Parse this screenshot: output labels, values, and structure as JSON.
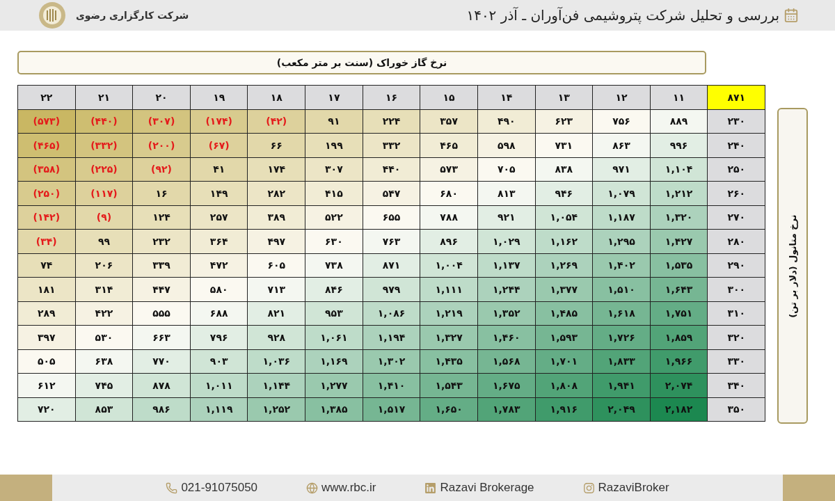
{
  "header": {
    "title": "بررسی و تحلیل شرکت پتروشیمی فن‌آوران ـ آذر ۱۴۰۲",
    "company": "شرکت کارگزاری رضوی"
  },
  "table_title": "نرخ گاز خوراک (سنت بر متر مکعب)",
  "side_label": "نرخ متانول (دلار بر تن)",
  "table": {
    "corner": "۸۷۱",
    "columns": [
      "۱۱",
      "۱۲",
      "۱۳",
      "۱۴",
      "۱۵",
      "۱۶",
      "۱۷",
      "۱۸",
      "۱۹",
      "۲۰",
      "۲۱",
      "۲۲"
    ],
    "rows": [
      {
        "label": "۲۳۰",
        "cells": [
          {
            "value": "۸۸۹",
            "negative": false
          },
          {
            "value": "۷۵۶",
            "negative": false
          },
          {
            "value": "۶۲۳",
            "negative": false
          },
          {
            "value": "۴۹۰",
            "negative": false
          },
          {
            "value": "۳۵۷",
            "negative": false
          },
          {
            "value": "۲۲۴",
            "negative": false
          },
          {
            "value": "۹۱",
            "negative": false
          },
          {
            "value": "(۴۲)",
            "negative": true
          },
          {
            "value": "(۱۷۴)",
            "negative": true
          },
          {
            "value": "(۳۰۷)",
            "negative": true
          },
          {
            "value": "(۴۴۰)",
            "negative": true
          },
          {
            "value": "(۵۷۳)",
            "negative": true
          }
        ]
      },
      {
        "label": "۲۴۰",
        "cells": [
          {
            "value": "۹۹۶",
            "negative": false
          },
          {
            "value": "۸۶۳",
            "negative": false
          },
          {
            "value": "۷۳۱",
            "negative": false
          },
          {
            "value": "۵۹۸",
            "negative": false
          },
          {
            "value": "۴۶۵",
            "negative": false
          },
          {
            "value": "۳۳۲",
            "negative": false
          },
          {
            "value": "۱۹۹",
            "negative": false
          },
          {
            "value": "۶۶",
            "negative": false
          },
          {
            "value": "(۶۷)",
            "negative": true
          },
          {
            "value": "(۲۰۰)",
            "negative": true
          },
          {
            "value": "(۳۳۲)",
            "negative": true
          },
          {
            "value": "(۴۶۵)",
            "negative": true
          }
        ]
      },
      {
        "label": "۲۵۰",
        "cells": [
          {
            "value": "۱,۱۰۴",
            "negative": false
          },
          {
            "value": "۹۷۱",
            "negative": false
          },
          {
            "value": "۸۳۸",
            "negative": false
          },
          {
            "value": "۷۰۵",
            "negative": false
          },
          {
            "value": "۵۷۳",
            "negative": false
          },
          {
            "value": "۴۴۰",
            "negative": false
          },
          {
            "value": "۳۰۷",
            "negative": false
          },
          {
            "value": "۱۷۴",
            "negative": false
          },
          {
            "value": "۴۱",
            "negative": false
          },
          {
            "value": "(۹۲)",
            "negative": true
          },
          {
            "value": "(۲۲۵)",
            "negative": true
          },
          {
            "value": "(۳۵۸)",
            "negative": true
          }
        ]
      },
      {
        "label": "۲۶۰",
        "cells": [
          {
            "value": "۱,۲۱۲",
            "negative": false
          },
          {
            "value": "۱,۰۷۹",
            "negative": false
          },
          {
            "value": "۹۴۶",
            "negative": false
          },
          {
            "value": "۸۱۳",
            "negative": false
          },
          {
            "value": "۶۸۰",
            "negative": false
          },
          {
            "value": "۵۴۷",
            "negative": false
          },
          {
            "value": "۴۱۵",
            "negative": false
          },
          {
            "value": "۲۸۲",
            "negative": false
          },
          {
            "value": "۱۴۹",
            "negative": false
          },
          {
            "value": "۱۶",
            "negative": false
          },
          {
            "value": "(۱۱۷)",
            "negative": true
          },
          {
            "value": "(۲۵۰)",
            "negative": true
          }
        ]
      },
      {
        "label": "۲۷۰",
        "cells": [
          {
            "value": "۱,۳۲۰",
            "negative": false
          },
          {
            "value": "۱,۱۸۷",
            "negative": false
          },
          {
            "value": "۱,۰۵۴",
            "negative": false
          },
          {
            "value": "۹۲۱",
            "negative": false
          },
          {
            "value": "۷۸۸",
            "negative": false
          },
          {
            "value": "۶۵۵",
            "negative": false
          },
          {
            "value": "۵۲۲",
            "negative": false
          },
          {
            "value": "۳۸۹",
            "negative": false
          },
          {
            "value": "۲۵۷",
            "negative": false
          },
          {
            "value": "۱۲۴",
            "negative": false
          },
          {
            "value": "(۹)",
            "negative": true
          },
          {
            "value": "(۱۴۲)",
            "negative": true
          }
        ]
      },
      {
        "label": "۲۸۰",
        "cells": [
          {
            "value": "۱,۴۲۷",
            "negative": false
          },
          {
            "value": "۱,۲۹۵",
            "negative": false
          },
          {
            "value": "۱,۱۶۲",
            "negative": false
          },
          {
            "value": "۱,۰۲۹",
            "negative": false
          },
          {
            "value": "۸۹۶",
            "negative": false
          },
          {
            "value": "۷۶۳",
            "negative": false
          },
          {
            "value": "۶۳۰",
            "negative": false
          },
          {
            "value": "۴۹۷",
            "negative": false
          },
          {
            "value": "۳۶۴",
            "negative": false
          },
          {
            "value": "۲۳۲",
            "negative": false
          },
          {
            "value": "۹۹",
            "negative": false
          },
          {
            "value": "(۳۴)",
            "negative": true
          }
        ]
      },
      {
        "label": "۲۹۰",
        "cells": [
          {
            "value": "۱,۵۳۵",
            "negative": false
          },
          {
            "value": "۱,۴۰۲",
            "negative": false
          },
          {
            "value": "۱,۲۶۹",
            "negative": false
          },
          {
            "value": "۱,۱۳۷",
            "negative": false
          },
          {
            "value": "۱,۰۰۴",
            "negative": false
          },
          {
            "value": "۸۷۱",
            "negative": false
          },
          {
            "value": "۷۳۸",
            "negative": false
          },
          {
            "value": "۶۰۵",
            "negative": false
          },
          {
            "value": "۴۷۲",
            "negative": false
          },
          {
            "value": "۳۳۹",
            "negative": false
          },
          {
            "value": "۲۰۶",
            "negative": false
          },
          {
            "value": "۷۴",
            "negative": false
          }
        ]
      },
      {
        "label": "۳۰۰",
        "cells": [
          {
            "value": "۱,۶۴۳",
            "negative": false
          },
          {
            "value": "۱,۵۱۰",
            "negative": false
          },
          {
            "value": "۱,۳۷۷",
            "negative": false
          },
          {
            "value": "۱,۲۴۴",
            "negative": false
          },
          {
            "value": "۱,۱۱۱",
            "negative": false
          },
          {
            "value": "۹۷۹",
            "negative": false
          },
          {
            "value": "۸۴۶",
            "negative": false
          },
          {
            "value": "۷۱۳",
            "negative": false
          },
          {
            "value": "۵۸۰",
            "negative": false
          },
          {
            "value": "۴۴۷",
            "negative": false
          },
          {
            "value": "۳۱۴",
            "negative": false
          },
          {
            "value": "۱۸۱",
            "negative": false
          }
        ]
      },
      {
        "label": "۳۱۰",
        "cells": [
          {
            "value": "۱,۷۵۱",
            "negative": false
          },
          {
            "value": "۱,۶۱۸",
            "negative": false
          },
          {
            "value": "۱,۴۸۵",
            "negative": false
          },
          {
            "value": "۱,۳۵۲",
            "negative": false
          },
          {
            "value": "۱,۲۱۹",
            "negative": false
          },
          {
            "value": "۱,۰۸۶",
            "negative": false
          },
          {
            "value": "۹۵۳",
            "negative": false
          },
          {
            "value": "۸۲۱",
            "negative": false
          },
          {
            "value": "۶۸۸",
            "negative": false
          },
          {
            "value": "۵۵۵",
            "negative": false
          },
          {
            "value": "۴۲۲",
            "negative": false
          },
          {
            "value": "۲۸۹",
            "negative": false
          }
        ]
      },
      {
        "label": "۳۲۰",
        "cells": [
          {
            "value": "۱,۸۵۹",
            "negative": false
          },
          {
            "value": "۱,۷۲۶",
            "negative": false
          },
          {
            "value": "۱,۵۹۳",
            "negative": false
          },
          {
            "value": "۱,۴۶۰",
            "negative": false
          },
          {
            "value": "۱,۳۲۷",
            "negative": false
          },
          {
            "value": "۱,۱۹۴",
            "negative": false
          },
          {
            "value": "۱,۰۶۱",
            "negative": false
          },
          {
            "value": "۹۲۸",
            "negative": false
          },
          {
            "value": "۷۹۶",
            "negative": false
          },
          {
            "value": "۶۶۳",
            "negative": false
          },
          {
            "value": "۵۳۰",
            "negative": false
          },
          {
            "value": "۳۹۷",
            "negative": false
          }
        ]
      },
      {
        "label": "۳۳۰",
        "cells": [
          {
            "value": "۱,۹۶۶",
            "negative": false
          },
          {
            "value": "۱,۸۳۳",
            "negative": false
          },
          {
            "value": "۱,۷۰۱",
            "negative": false
          },
          {
            "value": "۱,۵۶۸",
            "negative": false
          },
          {
            "value": "۱,۴۳۵",
            "negative": false
          },
          {
            "value": "۱,۳۰۲",
            "negative": false
          },
          {
            "value": "۱,۱۶۹",
            "negative": false
          },
          {
            "value": "۱,۰۳۶",
            "negative": false
          },
          {
            "value": "۹۰۳",
            "negative": false
          },
          {
            "value": "۷۷۰",
            "negative": false
          },
          {
            "value": "۶۳۸",
            "negative": false
          },
          {
            "value": "۵۰۵",
            "negative": false
          }
        ]
      },
      {
        "label": "۳۴۰",
        "cells": [
          {
            "value": "۲,۰۷۴",
            "negative": false
          },
          {
            "value": "۱,۹۴۱",
            "negative": false
          },
          {
            "value": "۱,۸۰۸",
            "negative": false
          },
          {
            "value": "۱,۶۷۵",
            "negative": false
          },
          {
            "value": "۱,۵۴۳",
            "negative": false
          },
          {
            "value": "۱,۴۱۰",
            "negative": false
          },
          {
            "value": "۱,۲۷۷",
            "negative": false
          },
          {
            "value": "۱,۱۴۴",
            "negative": false
          },
          {
            "value": "۱,۰۱۱",
            "negative": false
          },
          {
            "value": "۸۷۸",
            "negative": false
          },
          {
            "value": "۷۴۵",
            "negative": false
          },
          {
            "value": "۶۱۲",
            "negative": false
          }
        ]
      },
      {
        "label": "۳۵۰",
        "cells": [
          {
            "value": "۲,۱۸۲",
            "negative": false
          },
          {
            "value": "۲,۰۴۹",
            "negative": false
          },
          {
            "value": "۱,۹۱۶",
            "negative": false
          },
          {
            "value": "۱,۷۸۳",
            "negative": false
          },
          {
            "value": "۱,۶۵۰",
            "negative": false
          },
          {
            "value": "۱,۵۱۷",
            "negative": false
          },
          {
            "value": "۱,۳۸۵",
            "negative": false
          },
          {
            "value": "۱,۲۵۲",
            "negative": false
          },
          {
            "value": "۱,۱۱۹",
            "negative": false
          },
          {
            "value": "۹۸۶",
            "negative": false
          },
          {
            "value": "۸۵۳",
            "negative": false
          },
          {
            "value": "۷۲۰",
            "negative": false
          }
        ]
      }
    ]
  },
  "footer": [
    {
      "kind": "instagram",
      "text": "RazaviBroker"
    },
    {
      "kind": "linkedin",
      "text": "Razavi Brokerage"
    },
    {
      "kind": "web",
      "text": "www.rbc.ir"
    },
    {
      "kind": "phone",
      "text": "021-91075050"
    }
  ]
}
